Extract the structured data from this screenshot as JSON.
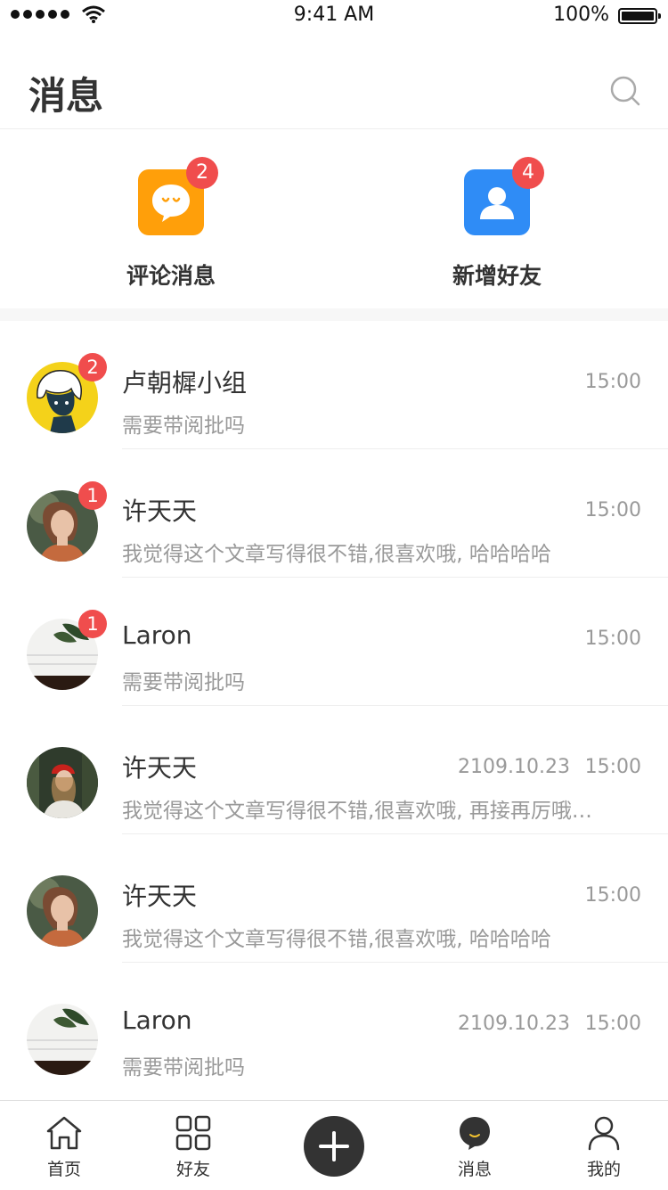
{
  "status_bar": {
    "time": "9:41 AM",
    "battery": "100%"
  },
  "header": {
    "title": "消息"
  },
  "quick_actions": [
    {
      "label": "评论消息",
      "badge": "2",
      "color": "#FF9F0A",
      "icon": "comment-bubble-icon"
    },
    {
      "label": "新增好友",
      "badge": "4",
      "color": "#2F8CF6",
      "icon": "user-icon"
    }
  ],
  "conversations": [
    {
      "name": "卢朝樨小组",
      "message": "需要带阅批吗",
      "date": "",
      "time": "15:00",
      "badge": "2"
    },
    {
      "name": "许天天",
      "message": "我觉得这个文章写得很不错,很喜欢哦, 哈哈哈哈",
      "date": "",
      "time": "15:00",
      "badge": "1"
    },
    {
      "name": "Laron",
      "message": "需要带阅批吗",
      "date": "",
      "time": "15:00",
      "badge": "1"
    },
    {
      "name": "许天天",
      "message": "我觉得这个文章写得很不错,很喜欢哦, 再接再厉哦…",
      "date": "2109.10.23",
      "time": "15:00",
      "badge": ""
    },
    {
      "name": "许天天",
      "message": "我觉得这个文章写得很不错,很喜欢哦, 哈哈哈哈",
      "date": "",
      "time": "15:00",
      "badge": ""
    },
    {
      "name": "Laron",
      "message": "需要带阅批吗",
      "date": "2109.10.23",
      "time": "15:00",
      "badge": ""
    }
  ],
  "tabbar": {
    "home": "首页",
    "friends": "好友",
    "messages": "消息",
    "mine": "我的"
  }
}
